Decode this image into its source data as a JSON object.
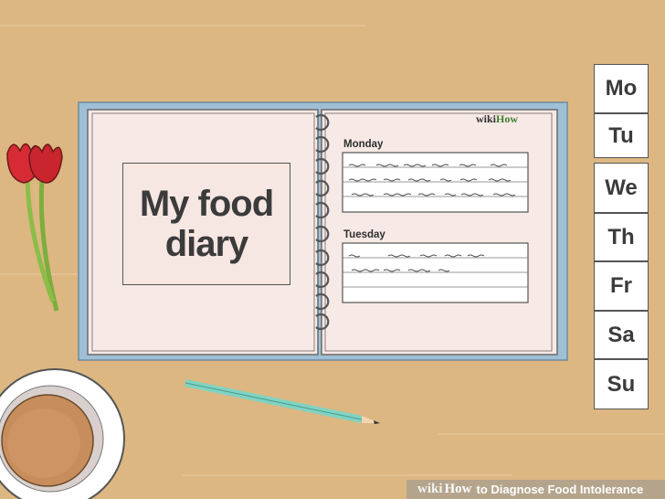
{
  "diary": {
    "cover_title": "My food\ndiary",
    "brand_wiki": "wiki",
    "brand_how": "How",
    "days": [
      "Monday",
      "Tuesday"
    ]
  },
  "day_tabs": [
    "Mo",
    "Tu",
    "We",
    "Th",
    "Fr",
    "Sa",
    "Su"
  ],
  "footer": {
    "wiki": "wiki",
    "how": "How",
    "title": "to Diagnose Food Intolerance"
  },
  "colors": {
    "table": "#dcb782",
    "notebook_cover": "#9fbfd6",
    "page": "#f7e9e6",
    "pencil": "#7fd3c2",
    "tulip": "#d62b34",
    "saucer": "#ffffff",
    "coffee": "#c88d5c"
  }
}
